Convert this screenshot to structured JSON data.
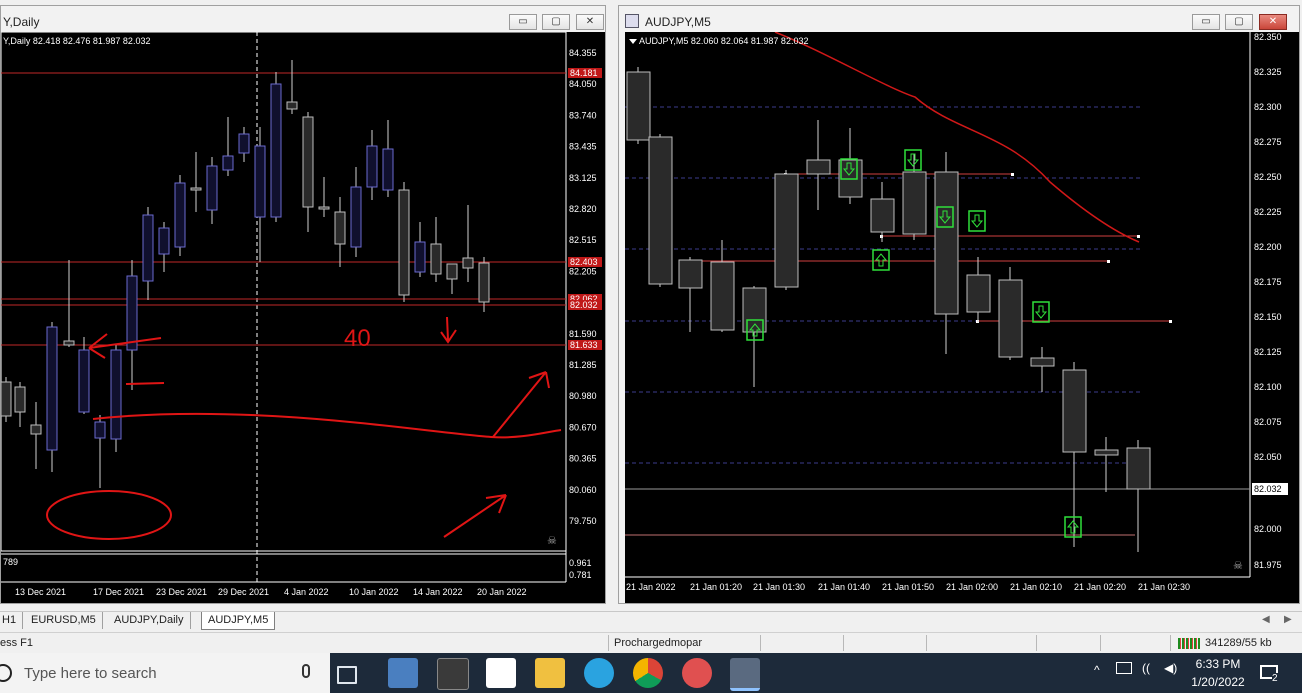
{
  "left_window": {
    "title": "Y,Daily",
    "ohlc": "Y,Daily  82.418 82.476 81.987 82.032",
    "price_labels": [
      "84.355",
      "84.050",
      "83.740",
      "83.435",
      "83.125",
      "82.820",
      "82.515",
      "82.205",
      "81.900",
      "81.590",
      "81.285",
      "80.980",
      "80.670",
      "80.365",
      "80.060",
      "79.750"
    ],
    "tags": [
      "84.181",
      "82.403",
      "82.062",
      "82.032",
      "81.633"
    ],
    "sub_labels": [
      "789",
      "0.961",
      "0.781"
    ],
    "dates": [
      "13 Dec 2021",
      "17 Dec 2021",
      "23 Dec 2021",
      "29 Dec 2021",
      "4 Jan 2022",
      "10 Jan 2022",
      "14 Jan 2022",
      "20 Jan 2022"
    ],
    "annotation": "40"
  },
  "right_window": {
    "title": "AUDJPY,M5",
    "ohlc": "AUDJPY,M5  82.060 82.064 81.987 82.032",
    "price_labels": [
      "82.350",
      "82.325",
      "82.300",
      "82.275",
      "82.250",
      "82.225",
      "82.200",
      "82.175",
      "82.150",
      "82.125",
      "82.100",
      "82.075",
      "82.050",
      "82.032",
      "82.000",
      "81.975"
    ],
    "times": [
      "21 Jan 2022",
      "21 Jan 01:20",
      "21 Jan 01:30",
      "21 Jan 01:40",
      "21 Jan 01:50",
      "21 Jan 02:00",
      "21 Jan 02:10",
      "21 Jan 02:20",
      "21 Jan 02:30"
    ]
  },
  "tabs": [
    "H1",
    "EURUSD,M5",
    "AUDJPY,Daily",
    "AUDJPY,M5"
  ],
  "status": {
    "help": "ess F1",
    "profile": "Prochargedmopar",
    "traffic": "341289/55 kb"
  },
  "taskbar": {
    "search_placeholder": "Type here to search",
    "time": "6:33 PM",
    "date": "1/20/2022",
    "notif_count": "2"
  },
  "window_buttons": {
    "minimize": "▭",
    "maximize": "▢",
    "close": "✕"
  },
  "colors": {
    "bull_fill": "#10102e",
    "bull_stroke": "#6a6acf",
    "bear_fill": "#2a2a2a",
    "level": "#c02828",
    "tag_bg": "#c01818",
    "signal": "#2fe03a"
  }
}
